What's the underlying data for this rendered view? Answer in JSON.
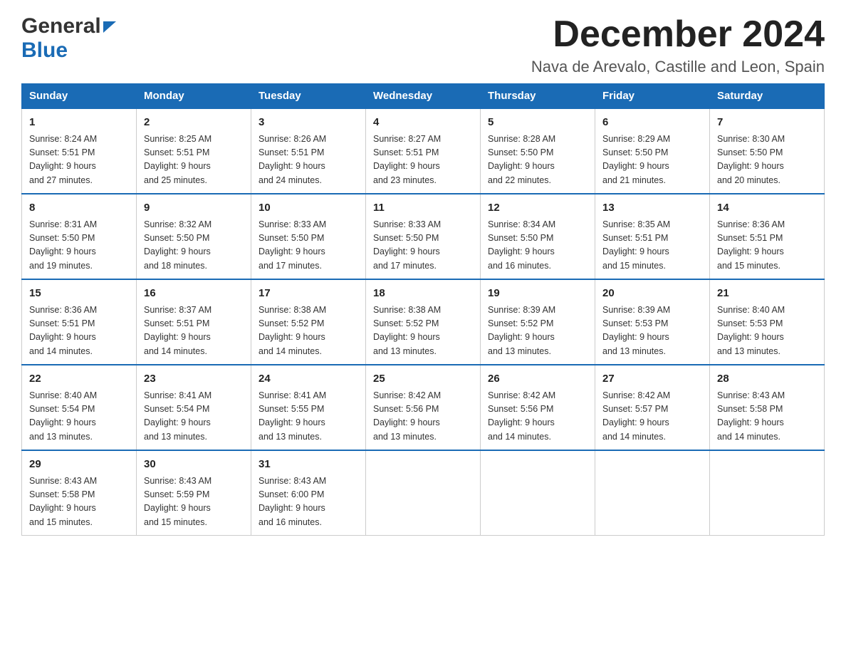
{
  "logo": {
    "general": "General",
    "blue": "Blue"
  },
  "title": "December 2024",
  "subtitle": "Nava de Arevalo, Castille and Leon, Spain",
  "days": [
    "Sunday",
    "Monday",
    "Tuesday",
    "Wednesday",
    "Thursday",
    "Friday",
    "Saturday"
  ],
  "weeks": [
    [
      {
        "day": "1",
        "info": "Sunrise: 8:24 AM\nSunset: 5:51 PM\nDaylight: 9 hours\nand 27 minutes."
      },
      {
        "day": "2",
        "info": "Sunrise: 8:25 AM\nSunset: 5:51 PM\nDaylight: 9 hours\nand 25 minutes."
      },
      {
        "day": "3",
        "info": "Sunrise: 8:26 AM\nSunset: 5:51 PM\nDaylight: 9 hours\nand 24 minutes."
      },
      {
        "day": "4",
        "info": "Sunrise: 8:27 AM\nSunset: 5:51 PM\nDaylight: 9 hours\nand 23 minutes."
      },
      {
        "day": "5",
        "info": "Sunrise: 8:28 AM\nSunset: 5:50 PM\nDaylight: 9 hours\nand 22 minutes."
      },
      {
        "day": "6",
        "info": "Sunrise: 8:29 AM\nSunset: 5:50 PM\nDaylight: 9 hours\nand 21 minutes."
      },
      {
        "day": "7",
        "info": "Sunrise: 8:30 AM\nSunset: 5:50 PM\nDaylight: 9 hours\nand 20 minutes."
      }
    ],
    [
      {
        "day": "8",
        "info": "Sunrise: 8:31 AM\nSunset: 5:50 PM\nDaylight: 9 hours\nand 19 minutes."
      },
      {
        "day": "9",
        "info": "Sunrise: 8:32 AM\nSunset: 5:50 PM\nDaylight: 9 hours\nand 18 minutes."
      },
      {
        "day": "10",
        "info": "Sunrise: 8:33 AM\nSunset: 5:50 PM\nDaylight: 9 hours\nand 17 minutes."
      },
      {
        "day": "11",
        "info": "Sunrise: 8:33 AM\nSunset: 5:50 PM\nDaylight: 9 hours\nand 17 minutes."
      },
      {
        "day": "12",
        "info": "Sunrise: 8:34 AM\nSunset: 5:50 PM\nDaylight: 9 hours\nand 16 minutes."
      },
      {
        "day": "13",
        "info": "Sunrise: 8:35 AM\nSunset: 5:51 PM\nDaylight: 9 hours\nand 15 minutes."
      },
      {
        "day": "14",
        "info": "Sunrise: 8:36 AM\nSunset: 5:51 PM\nDaylight: 9 hours\nand 15 minutes."
      }
    ],
    [
      {
        "day": "15",
        "info": "Sunrise: 8:36 AM\nSunset: 5:51 PM\nDaylight: 9 hours\nand 14 minutes."
      },
      {
        "day": "16",
        "info": "Sunrise: 8:37 AM\nSunset: 5:51 PM\nDaylight: 9 hours\nand 14 minutes."
      },
      {
        "day": "17",
        "info": "Sunrise: 8:38 AM\nSunset: 5:52 PM\nDaylight: 9 hours\nand 14 minutes."
      },
      {
        "day": "18",
        "info": "Sunrise: 8:38 AM\nSunset: 5:52 PM\nDaylight: 9 hours\nand 13 minutes."
      },
      {
        "day": "19",
        "info": "Sunrise: 8:39 AM\nSunset: 5:52 PM\nDaylight: 9 hours\nand 13 minutes."
      },
      {
        "day": "20",
        "info": "Sunrise: 8:39 AM\nSunset: 5:53 PM\nDaylight: 9 hours\nand 13 minutes."
      },
      {
        "day": "21",
        "info": "Sunrise: 8:40 AM\nSunset: 5:53 PM\nDaylight: 9 hours\nand 13 minutes."
      }
    ],
    [
      {
        "day": "22",
        "info": "Sunrise: 8:40 AM\nSunset: 5:54 PM\nDaylight: 9 hours\nand 13 minutes."
      },
      {
        "day": "23",
        "info": "Sunrise: 8:41 AM\nSunset: 5:54 PM\nDaylight: 9 hours\nand 13 minutes."
      },
      {
        "day": "24",
        "info": "Sunrise: 8:41 AM\nSunset: 5:55 PM\nDaylight: 9 hours\nand 13 minutes."
      },
      {
        "day": "25",
        "info": "Sunrise: 8:42 AM\nSunset: 5:56 PM\nDaylight: 9 hours\nand 13 minutes."
      },
      {
        "day": "26",
        "info": "Sunrise: 8:42 AM\nSunset: 5:56 PM\nDaylight: 9 hours\nand 14 minutes."
      },
      {
        "day": "27",
        "info": "Sunrise: 8:42 AM\nSunset: 5:57 PM\nDaylight: 9 hours\nand 14 minutes."
      },
      {
        "day": "28",
        "info": "Sunrise: 8:43 AM\nSunset: 5:58 PM\nDaylight: 9 hours\nand 14 minutes."
      }
    ],
    [
      {
        "day": "29",
        "info": "Sunrise: 8:43 AM\nSunset: 5:58 PM\nDaylight: 9 hours\nand 15 minutes."
      },
      {
        "day": "30",
        "info": "Sunrise: 8:43 AM\nSunset: 5:59 PM\nDaylight: 9 hours\nand 15 minutes."
      },
      {
        "day": "31",
        "info": "Sunrise: 8:43 AM\nSunset: 6:00 PM\nDaylight: 9 hours\nand 16 minutes."
      },
      {
        "day": "",
        "info": ""
      },
      {
        "day": "",
        "info": ""
      },
      {
        "day": "",
        "info": ""
      },
      {
        "day": "",
        "info": ""
      }
    ]
  ]
}
